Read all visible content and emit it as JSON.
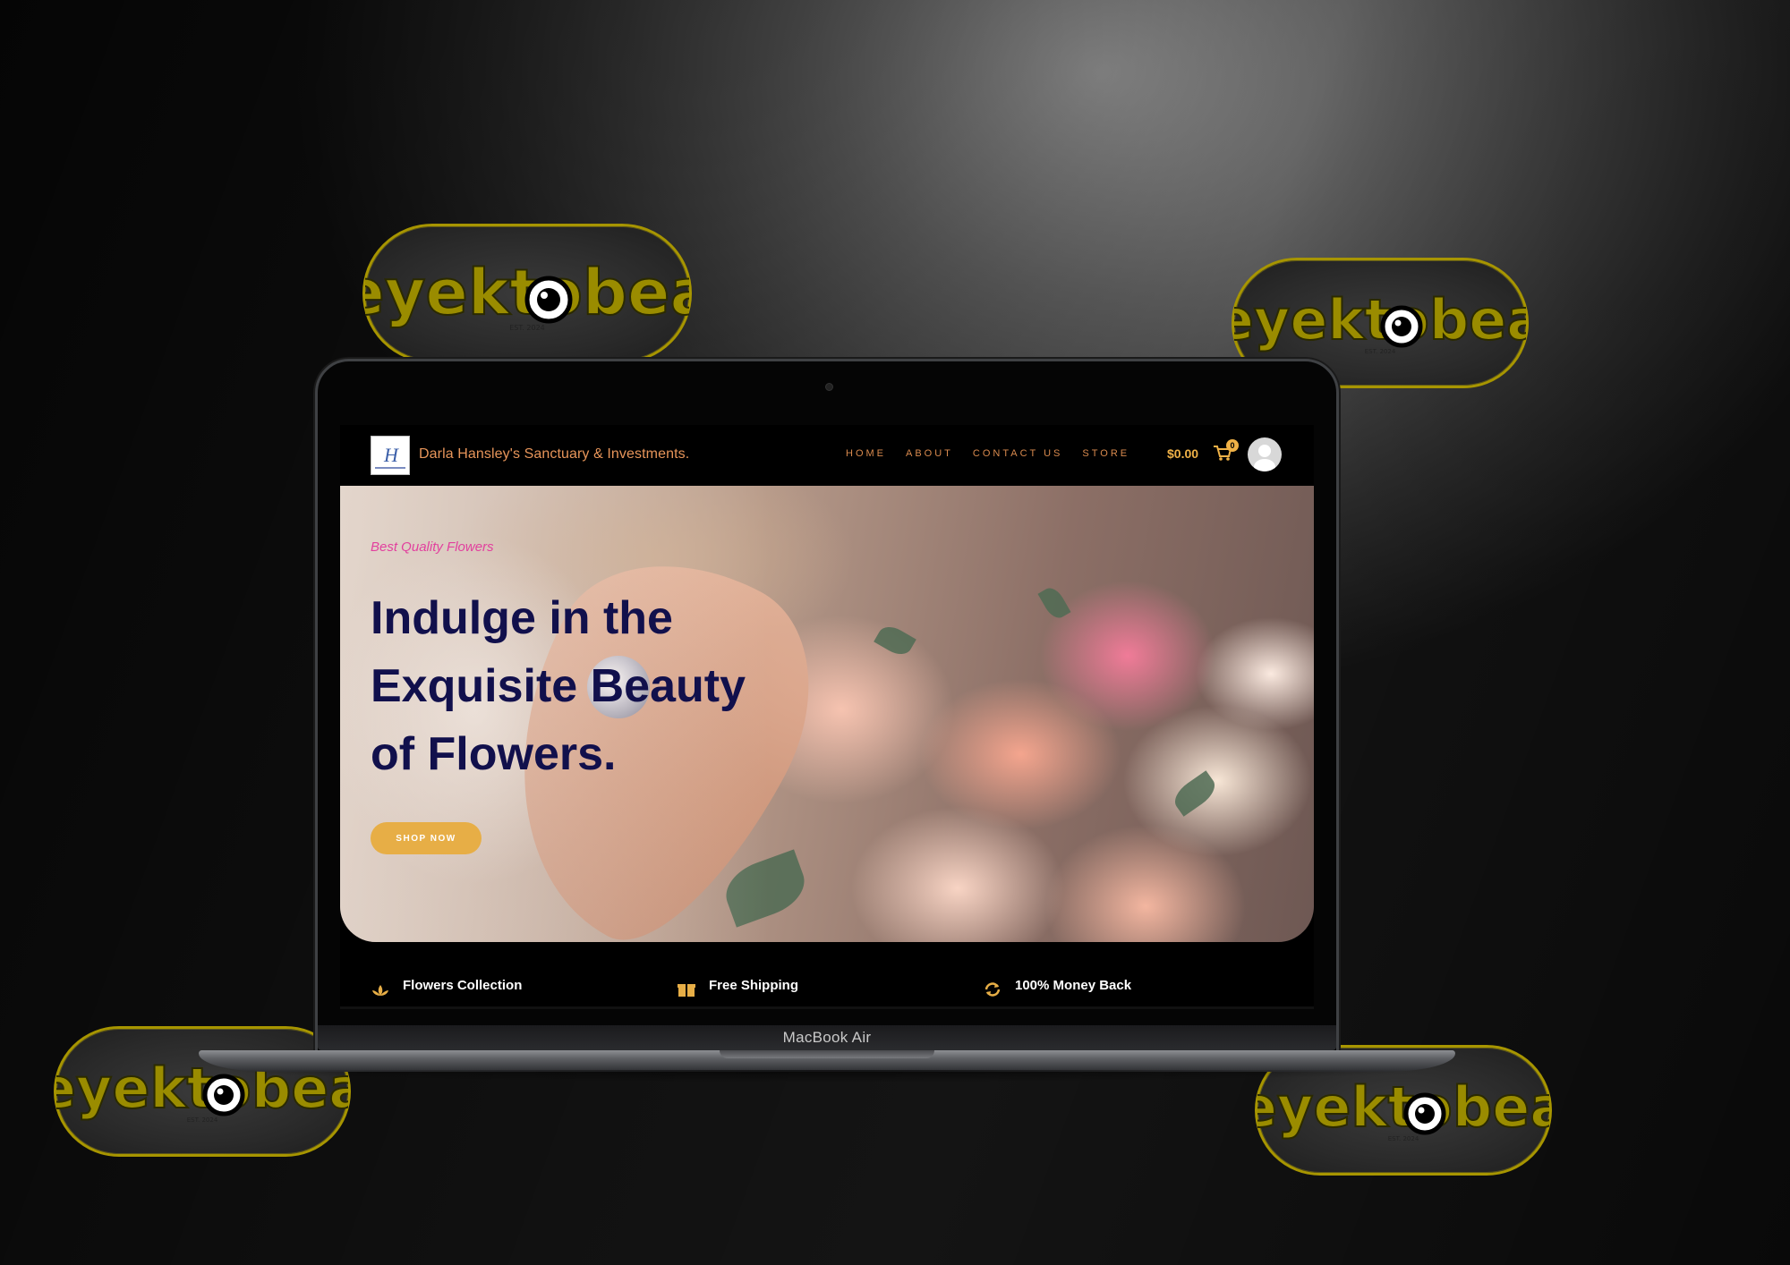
{
  "watermark": {
    "brand_name": "eyektobea",
    "tagline": "EST. 2024"
  },
  "device": {
    "model_label": "MacBook Air"
  },
  "site": {
    "brand_name": "Darla Hansley's Sanctuary & Investments.",
    "logo_text": "H",
    "nav": {
      "home": "HOME",
      "about": "ABOUT",
      "contact": "CONTACT US",
      "store": "STORE"
    },
    "cart": {
      "total": "$0.00",
      "count": "0"
    }
  },
  "hero": {
    "tagline": "Best Quality Flowers",
    "title_line1": "Indulge in the",
    "title_line2": "Exquisite Beauty",
    "title_line3": "of Flowers.",
    "cta_label": "SHOP NOW"
  },
  "features": [
    {
      "label": "Flowers Collection",
      "icon": "flower-icon"
    },
    {
      "label": "Free Shipping",
      "icon": "gift-box-icon"
    },
    {
      "label": "100% Money Back",
      "icon": "refresh-icon"
    }
  ],
  "colors": {
    "accent": "#e7ae46",
    "nav_text": "#d98a4e",
    "title": "#11104c",
    "tag": "#e2409e",
    "watermark_yellow": "#e6d800"
  }
}
